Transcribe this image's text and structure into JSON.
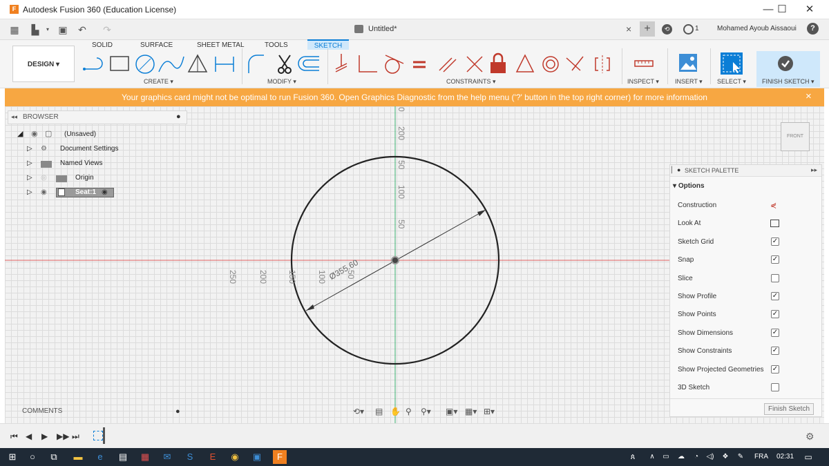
{
  "title_bar": {
    "app_icon": "F",
    "title": "Autodesk Fusion 360 (Education License)",
    "minimize": "—",
    "maximize": "☐",
    "close": "✕"
  },
  "qat": {
    "doc_title": "Untitled*",
    "close_tab": "×",
    "add_tab": "+",
    "jobs_count": "1",
    "user": "Mohamed Ayoub Aissaoui",
    "help": "?"
  },
  "ribbon": {
    "tabs": [
      "SOLID",
      "SURFACE",
      "SHEET METAL",
      "TOOLS",
      "SKETCH"
    ],
    "workspace": "DESIGN ▾",
    "groups": {
      "create": "CREATE ▾",
      "modify": "MODIFY ▾",
      "constraints": "CONSTRAINTS ▾",
      "inspect": "INSPECT ▾",
      "insert": "INSERT ▾",
      "select": "SELECT ▾",
      "finish": "FINISH SKETCH ▾"
    }
  },
  "warning": {
    "text": "Your graphics card might not be optimal to run Fusion 360. Open Graphics Diagnostic from the help menu ('?' button in the top right corner) for more information",
    "close": "×"
  },
  "browser": {
    "title": "BROWSER",
    "items": [
      {
        "label": "(Unsaved)"
      },
      {
        "label": "Document Settings"
      },
      {
        "label": "Named Views"
      },
      {
        "label": "Origin"
      },
      {
        "label": "Seat:1"
      }
    ]
  },
  "canvas": {
    "dimension": "Ø355.60",
    "h_ticks": [
      "250",
      "200",
      "150",
      "100",
      "50"
    ],
    "v_ticks": [
      "0",
      "200",
      "50",
      "100",
      "50"
    ]
  },
  "viewcube": {
    "face": "FRONT"
  },
  "palette": {
    "title": "SKETCH PALETTE",
    "options_header": "Options",
    "rows": [
      {
        "label": "Construction",
        "type": "icon"
      },
      {
        "label": "Look At",
        "type": "icon"
      },
      {
        "label": "Sketch Grid",
        "checked": true
      },
      {
        "label": "Snap",
        "checked": true
      },
      {
        "label": "Slice",
        "checked": false
      },
      {
        "label": "Show Profile",
        "checked": true
      },
      {
        "label": "Show Points",
        "checked": true
      },
      {
        "label": "Show Dimensions",
        "checked": true
      },
      {
        "label": "Show Constraints",
        "checked": true
      },
      {
        "label": "Show Projected Geometries",
        "checked": true
      },
      {
        "label": "3D Sketch",
        "checked": false
      }
    ],
    "finish_button": "Finish Sketch"
  },
  "comments": {
    "title": "COMMENTS"
  },
  "taskbar": {
    "lang": "FRA",
    "time": "02:31"
  },
  "colors": {
    "accent": "#0b7ed6",
    "warning": "#f7a742",
    "axis_red": "#e06060",
    "axis_green": "#3cb371"
  }
}
